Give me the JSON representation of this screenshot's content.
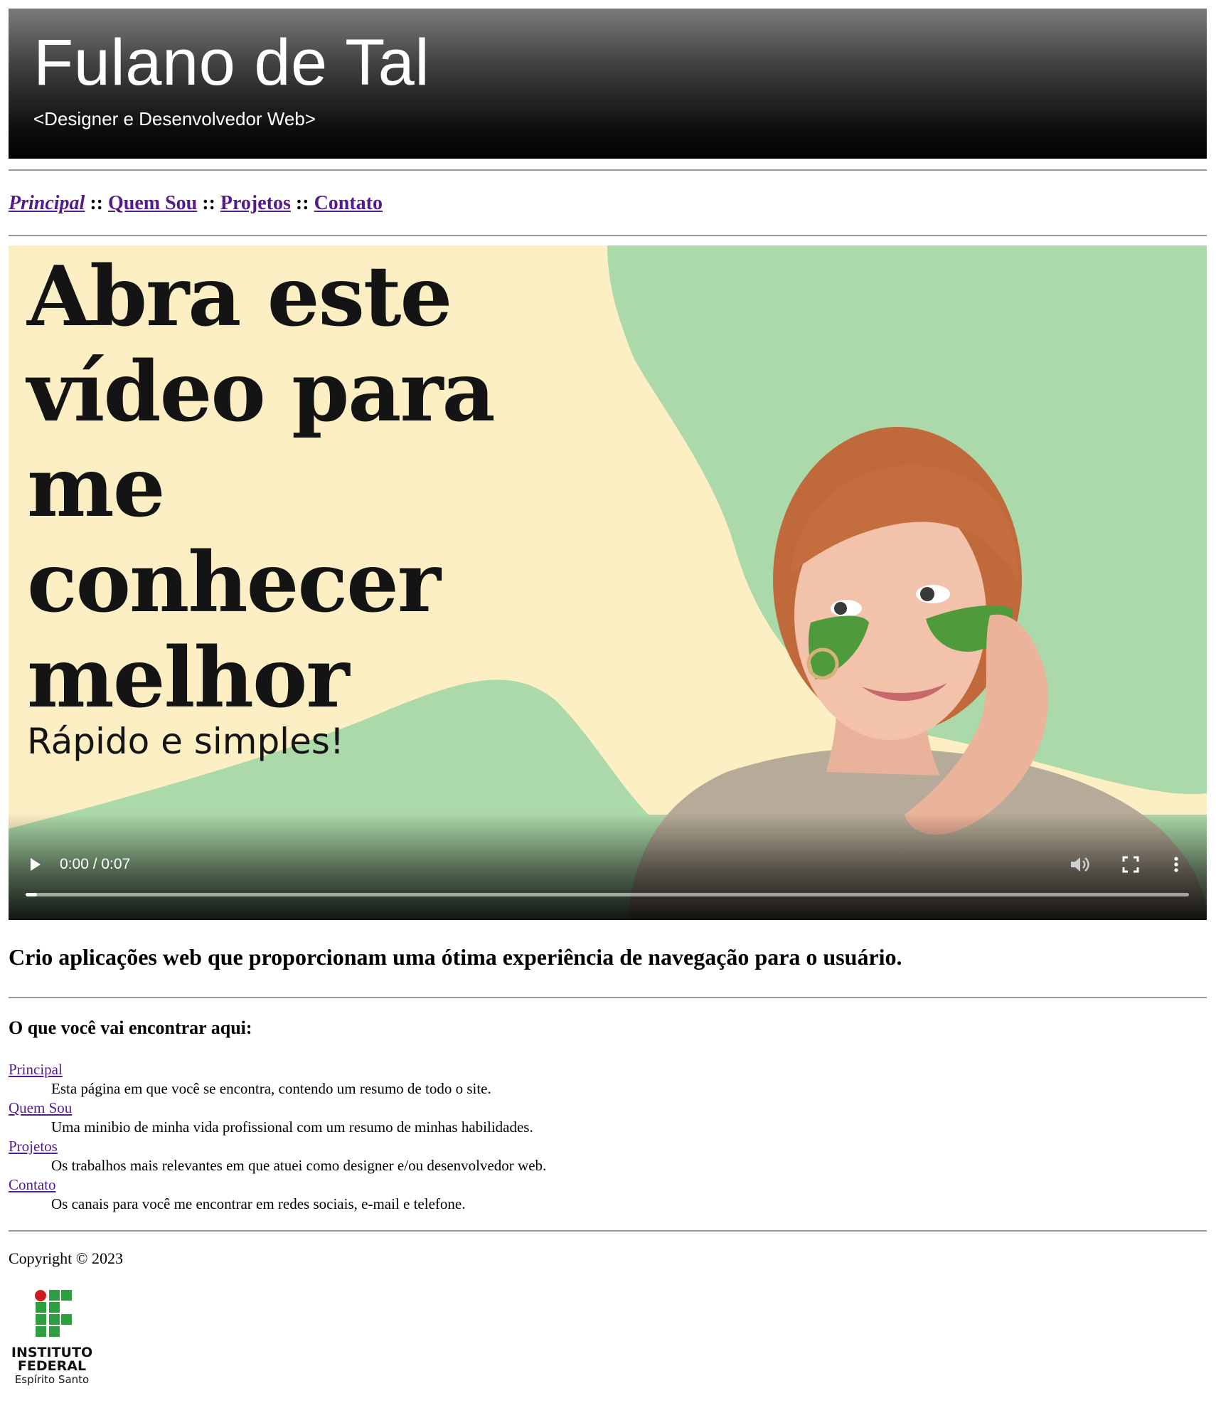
{
  "header": {
    "name": "Fulano de Tal",
    "role": "<Designer e Desenvolvedor Web>"
  },
  "nav": {
    "items": [
      "Principal",
      "Quem Sou",
      "Projetos",
      "Contato"
    ],
    "separator": "::",
    "active": "Principal"
  },
  "video": {
    "headline_lines": [
      "Abra este",
      "vídeo para",
      "me",
      "conhecer",
      "melhor"
    ],
    "subheadline": "Rápido e simples!",
    "time": "0:00 / 0:07",
    "progress": 0.0,
    "colors": {
      "cream": "#fcefc4",
      "green": "#acd9a9"
    }
  },
  "tagline": "Crio aplicações web que proporcionam uma ótima experiência de navegação para o usuário.",
  "section": {
    "title": "O que você vai encontrar aqui:",
    "items": [
      {
        "term": "Principal",
        "desc": "Esta página em que você se encontra, contendo um resumo de todo o site."
      },
      {
        "term": "Quem Sou",
        "desc": "Uma minibio de minha vida profissional com um resumo de minhas habilidades."
      },
      {
        "term": "Projetos",
        "desc": "Os trabalhos mais relevantes em que atuei como designer e/ou desenvolvedor web."
      },
      {
        "term": "Contato",
        "desc": "Os canais para você me encontrar em redes sociais, e-mail e telefone."
      }
    ]
  },
  "footer": {
    "copyright": "Copyright © 2023",
    "logo": {
      "line1": "INSTITUTO",
      "line2": "FEDERAL",
      "line3": "Espírito Santo",
      "green": "#2f9e41",
      "red": "#cd191e"
    }
  },
  "colors": {
    "link_visited": "#551a8b",
    "rule": "#9a9a9a"
  }
}
